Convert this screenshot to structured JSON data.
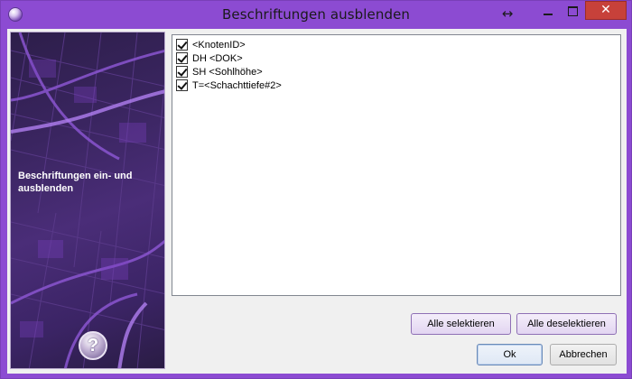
{
  "window": {
    "title": "Beschriftungen ausblenden",
    "resize_glyph": "↔",
    "close_glyph": "✕"
  },
  "side_panel": {
    "caption": "Beschriftungen ein- und ausblenden",
    "help_glyph": "?"
  },
  "labels_list": {
    "items": [
      {
        "label": "<KnotenID>",
        "checked": true
      },
      {
        "label": "DH <DOK>",
        "checked": true
      },
      {
        "label": "SH <Sohlhöhe>",
        "checked": true
      },
      {
        "label": "T=<Schachttiefe#2>",
        "checked": true
      }
    ]
  },
  "buttons": {
    "select_all": "Alle selektieren",
    "deselect_all": "Alle deselektieren",
    "ok": "Ok",
    "cancel": "Abbrechen"
  },
  "colors": {
    "title_bar": "#8c4bd2",
    "close_button": "#c7413a",
    "dialog_background": "#f0f0f0",
    "side_panel_accent": "#7a3fc0"
  }
}
